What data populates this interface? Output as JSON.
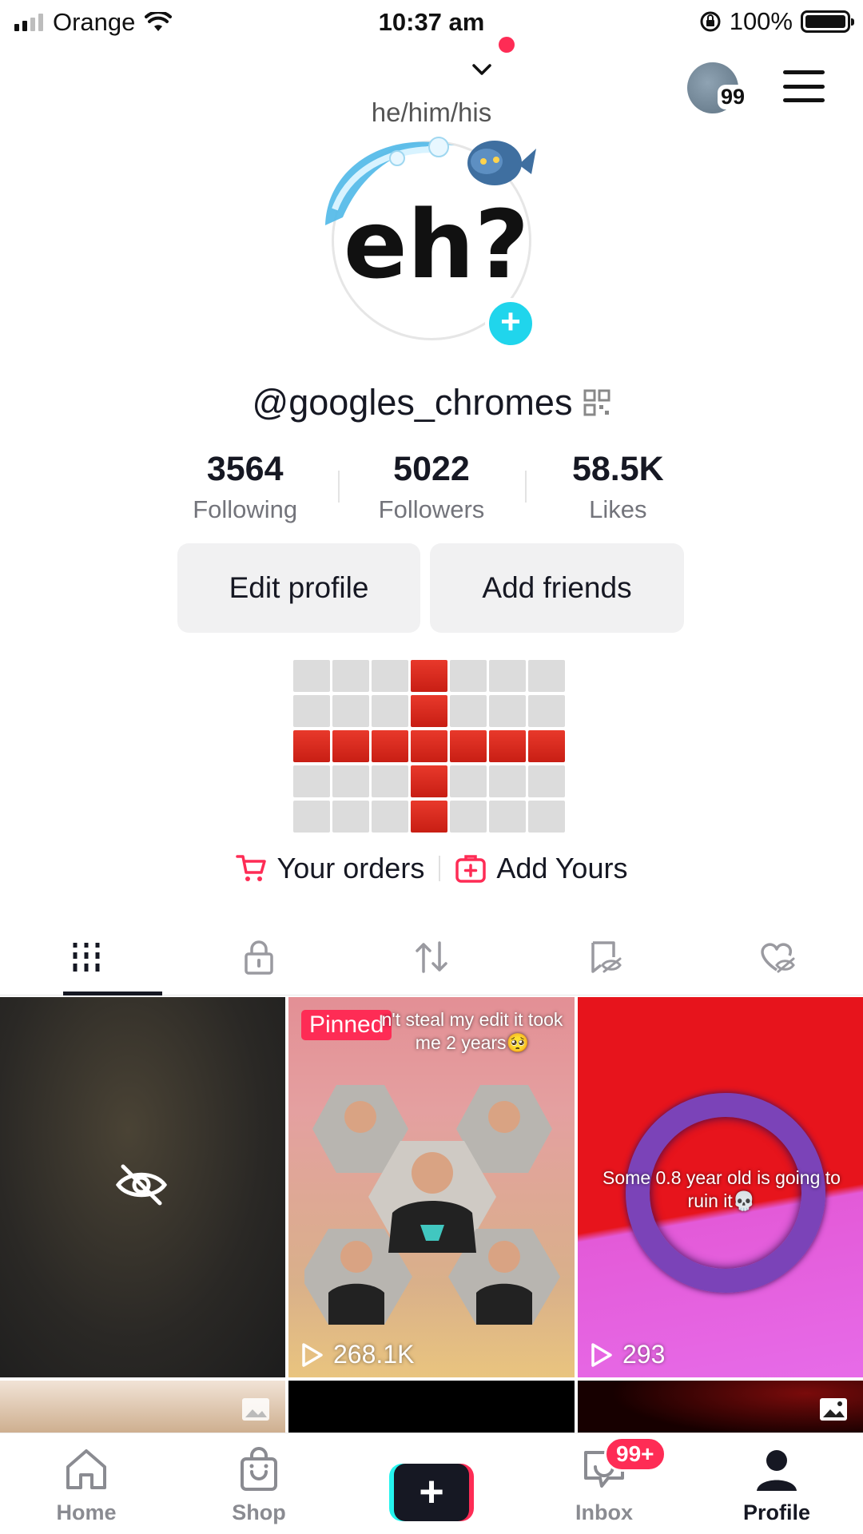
{
  "status_bar": {
    "carrier": "Orange",
    "time": "10:37 am",
    "battery": "100%",
    "icons": [
      "signal-icon",
      "wifi-icon",
      "orientation-lock-icon",
      "battery-icon"
    ]
  },
  "header": {
    "notification_count": "99",
    "icons": [
      "chevron-down-icon",
      "menu-icon"
    ]
  },
  "profile": {
    "pronouns": "he/him/his",
    "avatar_text": "eh?",
    "username": "@googles_chromes",
    "stats": [
      {
        "value": "3564",
        "label": "Following"
      },
      {
        "value": "5022",
        "label": "Followers"
      },
      {
        "value": "58.5K",
        "label": "Likes"
      }
    ],
    "buttons": {
      "edit": "Edit profile",
      "add_friends": "Add friends"
    },
    "links": {
      "orders": "Your orders",
      "add_yours": "Add Yours"
    },
    "flag_colors": {
      "red": "#d9261c",
      "gray": "#dcdcdc"
    }
  },
  "tabs": [
    {
      "name": "videos",
      "icon": "grid-icon",
      "active": true
    },
    {
      "name": "private",
      "icon": "lock-icon",
      "active": false
    },
    {
      "name": "reposts",
      "icon": "repost-icon",
      "active": false
    },
    {
      "name": "favorites",
      "icon": "bookmark-hidden-icon",
      "active": false
    },
    {
      "name": "liked",
      "icon": "heart-hidden-icon",
      "active": false
    }
  ],
  "videos": [
    {
      "hidden": true,
      "icon": "eye-off-icon"
    },
    {
      "pinned_label": "Pinned",
      "caption": "n't steal my edit it took me 2 years🥺",
      "views": "268.1K"
    },
    {
      "caption": "Some 0.8 year old is going to ruin it💀",
      "views": "293"
    }
  ],
  "bottom_nav": [
    {
      "label": "Home",
      "icon": "home-icon"
    },
    {
      "label": "Shop",
      "icon": "shop-bag-icon"
    },
    {
      "label": "",
      "icon": "plus-icon"
    },
    {
      "label": "Inbox",
      "icon": "inbox-icon",
      "badge": "99+"
    },
    {
      "label": "Profile",
      "icon": "profile-icon",
      "active": true
    }
  ],
  "colors": {
    "accent": "#fe2c55",
    "teal": "#20d5ec",
    "text_primary": "#161823",
    "text_secondary": "#73747b",
    "button_bg": "#f1f1f2"
  }
}
